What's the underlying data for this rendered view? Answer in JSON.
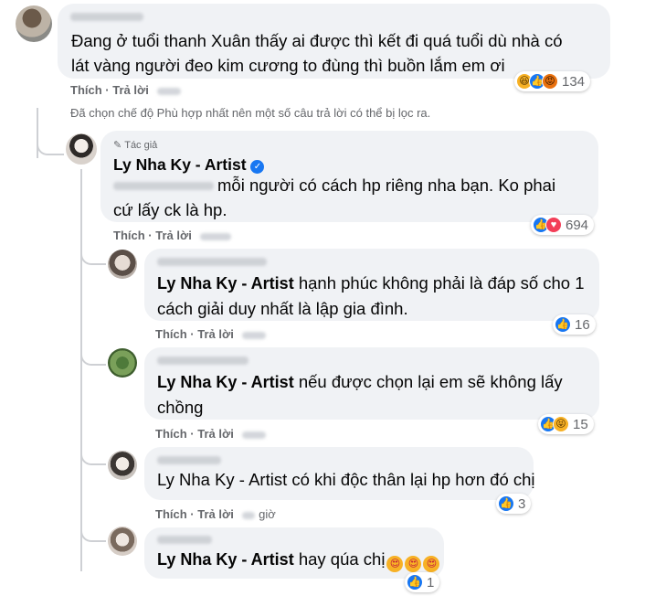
{
  "top_comment": {
    "text": "Đang ở tuổi thanh Xuân thấy ai được thì kết đi quá tuổi dù nhà có lát vàng người đeo kim cương to đùng thì buồn lắm em ơi",
    "reaction_count": "134"
  },
  "actions": {
    "like": "Thích",
    "reply": "Trả lời",
    "dot": "·"
  },
  "filter_notice": "Đã chọn chế độ Phù hợp nhất nên một số câu trả lời có thể bị lọc ra.",
  "author_reply": {
    "author_badge": "Tác giả",
    "name": "Ly Nha Ky - Artist",
    "text": "mỗi người có cách hp riêng nha bạn. Ko phai cứ lấy ck là hp.",
    "reaction_count": "694"
  },
  "replies": [
    {
      "mention": "Ly Nha Ky - Artist",
      "text": "hạnh phúc không phải là đáp số cho 1 cách giải duy nhất là lập gia đình.",
      "reaction_count": "16"
    },
    {
      "mention": "Ly Nha Ky - Artist",
      "text": "nếu được chọn lại em sẽ không lấy chồng",
      "reaction_count": "15"
    },
    {
      "mention": "Ly Nha Ky - Artist",
      "text": "có khi độc thân lại hp hơn đó chị",
      "reaction_count": "3",
      "time_suffix": "giờ"
    },
    {
      "mention": "Ly Nha Ky - Artist",
      "text": "hay qúa chị",
      "reaction_count": "1"
    }
  ],
  "icons": {
    "like": "thumbs-up",
    "love": "heart",
    "haha": "laughing-face",
    "angry": "angry-face",
    "wow": "squinting-face",
    "pen": "pen-icon",
    "verified": "verified-badge",
    "heart_eyes": "heart-eyes-emoji"
  },
  "colors": {
    "like": "#1877f2",
    "love": "#f33e58",
    "haha": "#f7b125",
    "bubble": "#f0f2f5",
    "meta": "#65676b",
    "thread": "#ced0d4"
  }
}
